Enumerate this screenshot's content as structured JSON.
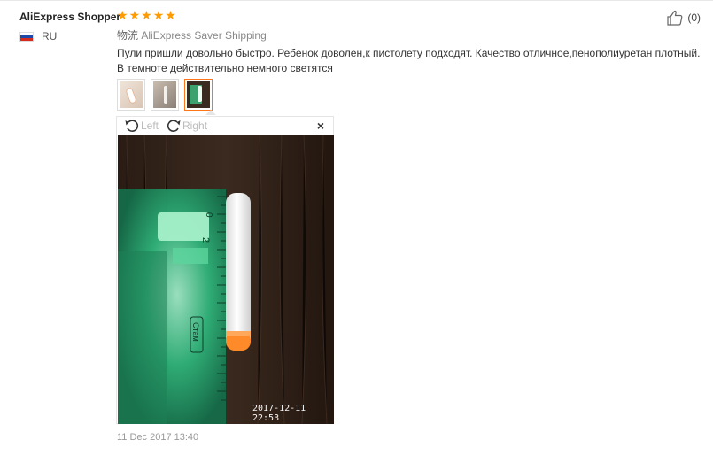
{
  "buyer": {
    "name": "AliExpress Shopper",
    "country": "RU"
  },
  "rating": {
    "stars": 5
  },
  "helpful": {
    "count": "(0)"
  },
  "shipping": {
    "label": "物流",
    "method": "AliExpress Saver Shipping"
  },
  "review": {
    "line1": "Пули пришли довольно быстро. Ребенок доволен,к пистолету подходят. Качество отличное,пенополиуретан плотный.",
    "line2": "В темноте действительно немного светятся"
  },
  "thumbnails": [
    {
      "name": "photo-1",
      "active": false
    },
    {
      "name": "photo-2",
      "active": false
    },
    {
      "name": "photo-3",
      "active": true
    }
  ],
  "viewer": {
    "rotate_left_label": "Left",
    "rotate_right_label": "Right",
    "close_label": "×",
    "photo_timestamp": "2017-12-11 22:53",
    "ruler_brand": "Стам",
    "ruler_ticks": [
      "0",
      "2"
    ]
  },
  "review_date": "11 Dec 2017 13:40",
  "icons": {
    "star": "star-icon",
    "thumbs_up": "thumbs-up-icon",
    "rotate_left": "rotate-left-icon",
    "rotate_right": "rotate-right-icon",
    "close": "close-icon"
  },
  "colors": {
    "star": "#ff9a00",
    "active_border": "#ff7519"
  }
}
